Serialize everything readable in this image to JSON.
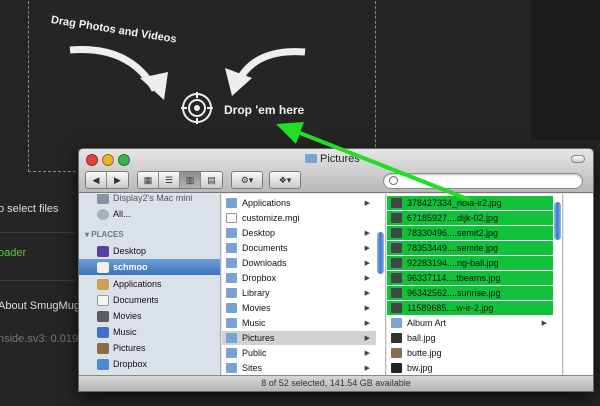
{
  "uploader": {
    "drag_caption": "Drag Photos and Videos",
    "drop_label": "Drop 'em here",
    "side_texts": [
      "o select files",
      "oader",
      "About SmugMug",
      "nside.sv3: 0.019"
    ]
  },
  "finder": {
    "title": "Pictures",
    "status": "8 of 52 selected, 141.54 GB available",
    "sidebar": {
      "top_items": [
        {
          "label": "Display2's Mac mini",
          "icon": "computer-icon"
        },
        {
          "label": "All...",
          "icon": "network-icon"
        }
      ],
      "places_header": "PLACES",
      "places": [
        {
          "label": "Desktop",
          "icon": "desktop-icon",
          "selected": false
        },
        {
          "label": "schmoo",
          "icon": "home-icon",
          "selected": true
        },
        {
          "label": "Applications",
          "icon": "applications-icon",
          "selected": false
        },
        {
          "label": "Documents",
          "icon": "documents-icon",
          "selected": false
        },
        {
          "label": "Movies",
          "icon": "movies-icon",
          "selected": false
        },
        {
          "label": "Music",
          "icon": "music-icon",
          "selected": false
        },
        {
          "label": "Pictures",
          "icon": "pictures-icon",
          "selected": false
        },
        {
          "label": "Dropbox",
          "icon": "dropbox-icon",
          "selected": false
        }
      ]
    },
    "column2": [
      {
        "label": "Applications",
        "folder": true
      },
      {
        "label": "customize.mgi",
        "folder": false
      },
      {
        "label": "Desktop",
        "folder": true
      },
      {
        "label": "Documents",
        "folder": true
      },
      {
        "label": "Downloads",
        "folder": true
      },
      {
        "label": "Dropbox",
        "folder": true
      },
      {
        "label": "Library",
        "folder": true
      },
      {
        "label": "Movies",
        "folder": true
      },
      {
        "label": "Music",
        "folder": true
      },
      {
        "label": "Pictures",
        "folder": true,
        "selected": true
      },
      {
        "label": "Public",
        "folder": true
      },
      {
        "label": "Sites",
        "folder": true
      }
    ],
    "column3": [
      {
        "label": "378427334_nola-ir2.jpg",
        "selected": true
      },
      {
        "label": "67185927....dijk-02.jpg",
        "selected": true
      },
      {
        "label": "78330496....semit2.jpg",
        "selected": true
      },
      {
        "label": "78353449....semite.jpg",
        "selected": true
      },
      {
        "label": "92283194....ng-ball.jpg",
        "selected": true
      },
      {
        "label": "96337114....tbeams.jpg",
        "selected": true
      },
      {
        "label": "96342562....sunrise.jpg",
        "selected": true
      },
      {
        "label": "11589685....w-ir-2.jpg",
        "selected": true
      },
      {
        "label": "Album Art",
        "selected": false,
        "folder": true
      },
      {
        "label": "ball.jpg",
        "selected": false
      },
      {
        "label": "butte.jpg",
        "selected": false
      },
      {
        "label": "bw.jpg",
        "selected": false
      }
    ]
  },
  "colors": {
    "selection_green": "#10c23a",
    "arrow_green": "#22dd22",
    "sidebar_selected": "#3d72b8"
  }
}
